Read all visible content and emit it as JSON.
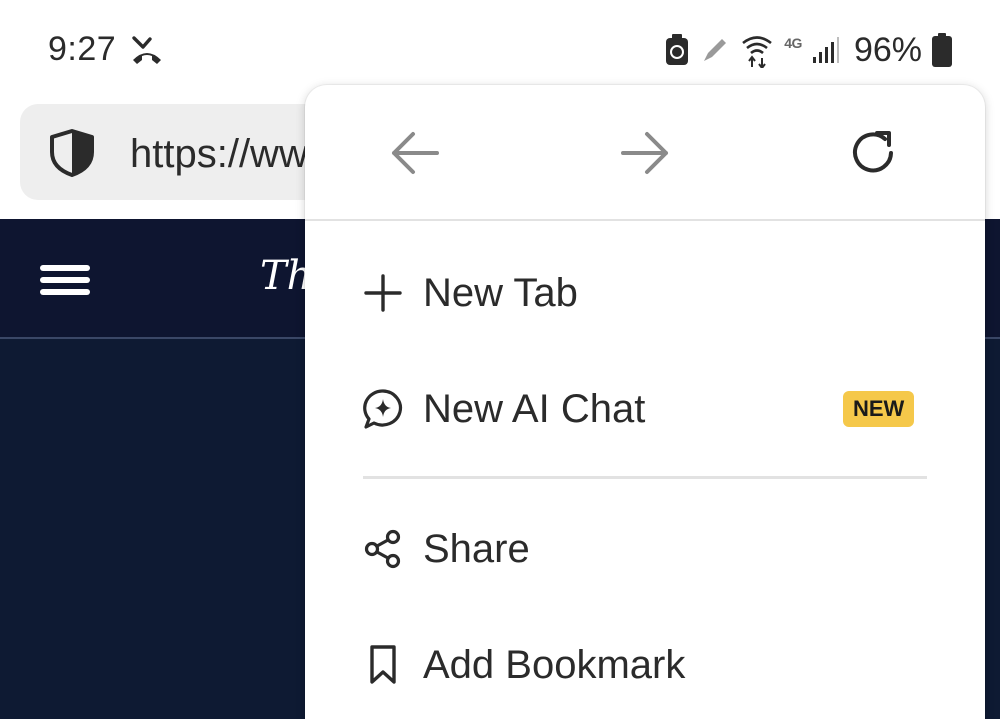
{
  "status_bar": {
    "time": "9:27",
    "network_label": "4G",
    "battery_percent": "96%",
    "icons": [
      "missed-call-icon",
      "battery-saver-icon",
      "pen-icon",
      "wifi-icon",
      "signal-icon",
      "battery-icon"
    ]
  },
  "address_bar": {
    "url": "https://ww",
    "security_icon": "shield-icon"
  },
  "site": {
    "title": "Th",
    "background_color": "#0e1a33",
    "menu_icon": "hamburger-icon"
  },
  "menu": {
    "nav": {
      "back_icon": "arrow-left-icon",
      "forward_icon": "arrow-right-icon",
      "reload_icon": "reload-icon"
    },
    "items": [
      {
        "label": "New Tab",
        "icon": "plus-icon"
      },
      {
        "label": "New AI Chat",
        "icon": "ai-chat-icon",
        "badge": "NEW"
      },
      {
        "label": "Share",
        "icon": "share-icon"
      },
      {
        "label": "Add Bookmark",
        "icon": "bookmark-icon"
      }
    ],
    "badge_color": "#f5c84a"
  }
}
